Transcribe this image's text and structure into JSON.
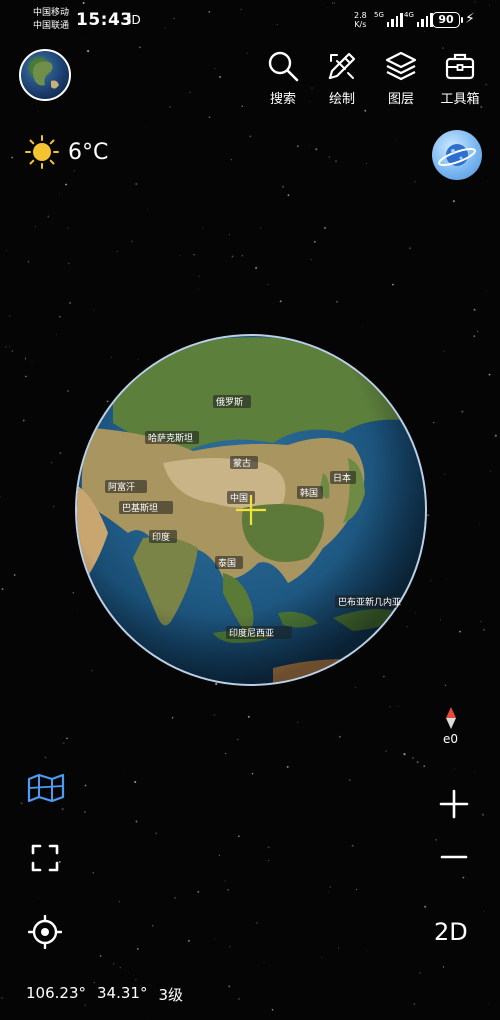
{
  "status_bar": {
    "carrier_1": "中国移动",
    "carrier_2": "中国联通",
    "time": "15:43",
    "sim_glyph": "ÌD",
    "net_speed_value": "2.8",
    "net_speed_unit": "K/s",
    "signal_1_tag": "5G",
    "signal_2_tag": "4G",
    "battery": "90"
  },
  "toolbar": {
    "search_label": "搜索",
    "draw_label": "绘制",
    "layers_label": "图层",
    "toolbox_label": "工具箱"
  },
  "weather": {
    "icon": "sun-icon",
    "temperature": "6°C"
  },
  "globe_labels": {
    "china": "中国",
    "india": "印度",
    "thailand": "泰国",
    "japan": "日本",
    "korea": "韩国",
    "mongolia": "蒙古",
    "indonesia": "印度尼西亚",
    "russia": "俄罗斯",
    "afghanistan": "阿富汗",
    "pakistan": "巴基斯坦",
    "kazakhstan": "哈萨克斯坦",
    "papua": "巴布亚新几内亚"
  },
  "compass": {
    "heading": "e0"
  },
  "controls": {
    "mode": "2D"
  },
  "footer": {
    "longitude": "106.23°",
    "latitude": "34.31°",
    "zoom_level": "3级"
  },
  "colors": {
    "background": "#050505",
    "accent_blue": "#4d9bf2",
    "crosshair": "#f2e23a",
    "compass_red": "#e84a3a"
  }
}
